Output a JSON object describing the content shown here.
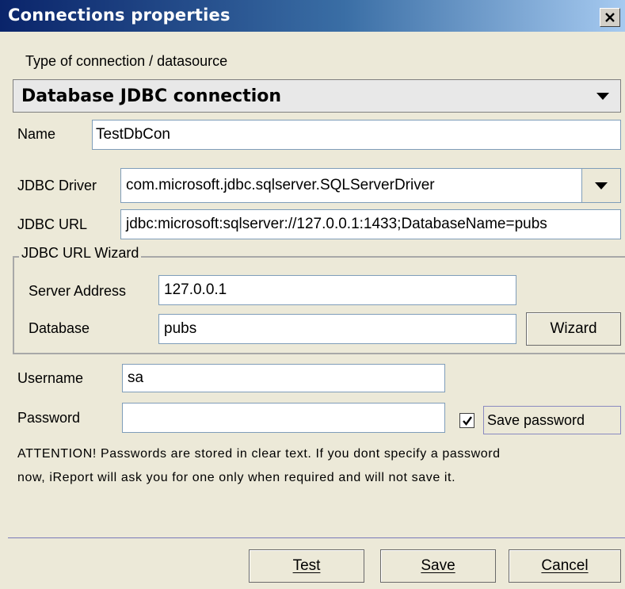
{
  "window": {
    "title": "Connections properties",
    "close_glyph": "×"
  },
  "type_section": {
    "label": "Type of connection / datasource",
    "selected": "Database JDBC connection"
  },
  "name": {
    "label": "Name",
    "value": "TestDbCon"
  },
  "jdbc_driver": {
    "label": "JDBC Driver",
    "value": "com.microsoft.jdbc.sqlserver.SQLServerDriver"
  },
  "jdbc_url": {
    "label": "JDBC URL",
    "value": "jdbc:microsoft:sqlserver://127.0.0.1:1433;DatabaseName=pubs"
  },
  "wizard_group": {
    "title": "JDBC URL Wizard",
    "server_label": "Server Address",
    "server_value": "127.0.0.1",
    "database_label": "Database",
    "database_value": "pubs",
    "wizard_button": "Wizard"
  },
  "credentials": {
    "username_label": "Username",
    "username_value": "sa",
    "password_label": "Password",
    "password_value": "",
    "save_password_label": "Save password",
    "save_password_checked": true
  },
  "attention": {
    "line1": "ATTENTION! Passwords are stored in clear text. If you dont specify a password",
    "line2": "now, iReport will ask you for one only when required and will not save it."
  },
  "buttons": {
    "test": "Test",
    "save": "Save",
    "cancel": "Cancel"
  }
}
